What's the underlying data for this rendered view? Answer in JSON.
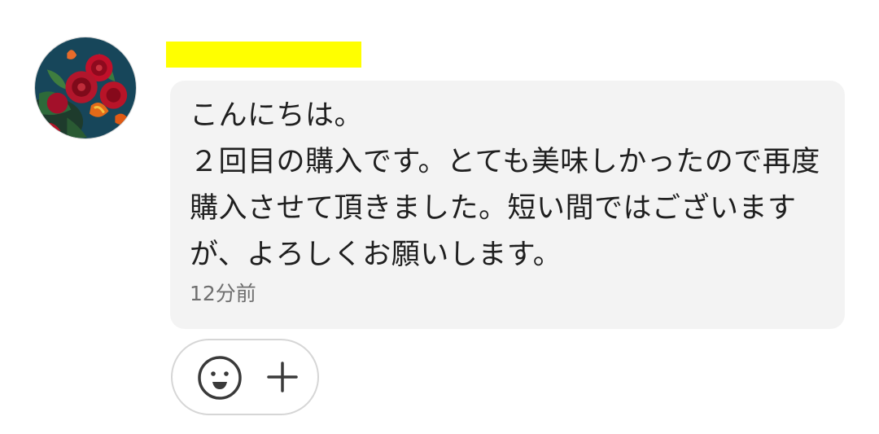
{
  "sender": {
    "name": ""
  },
  "message": {
    "text": "こんにちは。\n２回目の購入です。とても美味しかったので再度購入させて頂きました。短い間ではございますが、よろしくお願いします。",
    "timestamp": "12分前"
  },
  "reactions": {
    "emoji_icon": "smiley-face-icon",
    "add_icon": "plus-icon"
  },
  "colors": {
    "bubble": "#f3f3f3",
    "name_highlight": "#ffff00",
    "text": "#1f1f1f",
    "timestamp": "#6f6f6f"
  }
}
